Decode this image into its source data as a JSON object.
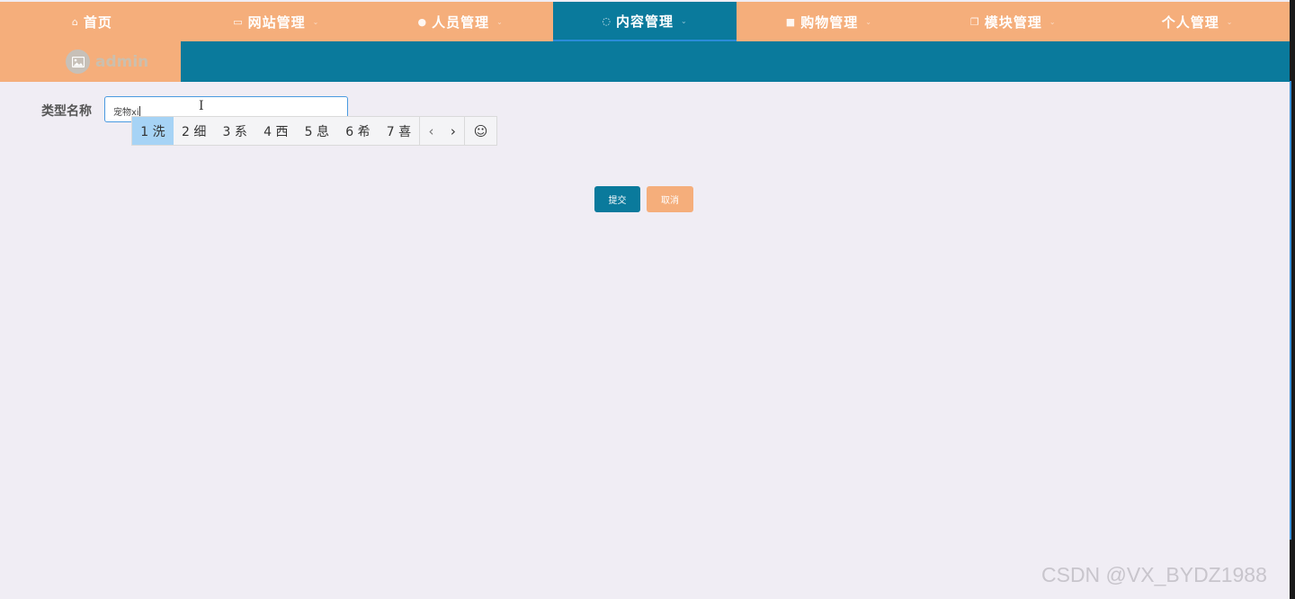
{
  "nav": {
    "items": [
      {
        "icon": "home-icon",
        "glyph": "⌂",
        "label": "首页",
        "dropdown": false,
        "active": false
      },
      {
        "icon": "monitor-icon",
        "glyph": "▭",
        "label": "网站管理",
        "dropdown": true,
        "active": false
      },
      {
        "icon": "user-icon",
        "glyph": "●",
        "label": "人员管理",
        "dropdown": true,
        "active": false
      },
      {
        "icon": "message-icon",
        "glyph": "◌",
        "label": "内容管理",
        "dropdown": true,
        "active": true
      },
      {
        "icon": "bag-icon",
        "glyph": "■",
        "label": "购物管理",
        "dropdown": true,
        "active": false
      },
      {
        "icon": "copy-icon",
        "glyph": "❐",
        "label": "模块管理",
        "dropdown": true,
        "active": false
      },
      {
        "icon": "none",
        "glyph": "",
        "label": "个人管理",
        "dropdown": true,
        "active": false
      }
    ],
    "chevron": "⌄"
  },
  "user": {
    "name": "admin",
    "avatar_icon": "image-icon"
  },
  "form": {
    "type_name_label": "类型名称",
    "type_name_value": "宠物xi",
    "submit_label": "提交",
    "cancel_label": "取消"
  },
  "ime": {
    "candidates": [
      "1 洗",
      "2 细",
      "3 系",
      "4 西",
      "5 息",
      "6 希",
      "7 喜"
    ],
    "selected_index": 0,
    "prev": "‹",
    "next": "›",
    "emoji": "☺"
  },
  "watermark": "CSDN @VX_BYDZ1988",
  "colors": {
    "primary": "#0a7a9c",
    "accent": "#f5ae7b",
    "background": "#f0edf4"
  }
}
